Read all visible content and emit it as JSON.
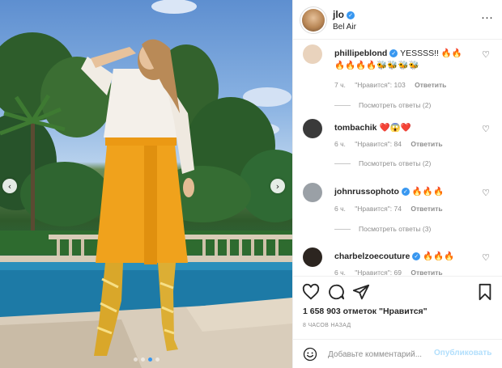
{
  "post": {
    "photo_nav": {
      "prev_icon": "chevron-left-icon",
      "next_icon": "chevron-right-icon",
      "prev_glyph": "‹",
      "next_glyph": "›"
    },
    "carousel": {
      "count": 4,
      "active_index": 2
    }
  },
  "header": {
    "username": "jlo",
    "verified_glyph": "✓",
    "location": "Bel Air",
    "more_glyph": "···"
  },
  "comments": [
    {
      "user": "phillipeblond",
      "text": "YESSSS!! 🔥🔥🔥🔥🔥🔥🐝🐝🐝🐝",
      "time": "7 ч.",
      "likes": "\"Нравится\": 103",
      "reply": "Ответить",
      "view_replies": "Посмотреть ответы (2)",
      "avatar_color": "#e9d3bd"
    },
    {
      "user": "tombachik",
      "text": "❤️😱❤️",
      "time": "6 ч.",
      "likes": "\"Нравится\": 84",
      "reply": "Ответить",
      "view_replies": "Посмотреть ответы (2)",
      "avatar_color": "#3a3a3a"
    },
    {
      "user": "johnrussophoto",
      "text": "🔥🔥🔥",
      "time": "6 ч.",
      "likes": "\"Нравится\": 74",
      "reply": "Ответить",
      "view_replies": "Посмотреть ответы (3)",
      "avatar_color": "#9aa0a6"
    },
    {
      "user": "charbelzoecouture",
      "text": "🔥🔥🔥",
      "time": "6 ч.",
      "likes": "\"Нравится\": 69",
      "reply": "Ответить",
      "view_replies": "",
      "avatar_color": "#2c2520"
    }
  ],
  "comment_like_glyph": "♡",
  "actions": {
    "like_icon": "heart-icon",
    "comment_icon": "comment-icon",
    "share_icon": "share-icon",
    "save_icon": "bookmark-icon",
    "likes_count": "1 658 903 отметок \"Нравится\"",
    "time_ago": "8 ЧАСОВ НАЗАД"
  },
  "add_comment": {
    "emoji_icon": "smile-icon",
    "placeholder": "Добавьте комментарий...",
    "publish_label": "Опубликовать"
  },
  "colors": {
    "accent": "#3897f0",
    "publish_disabled": "#b2dffc",
    "muted": "#8e8e8e",
    "skirt": "#f0a21c",
    "boots": "#d9a72a"
  }
}
